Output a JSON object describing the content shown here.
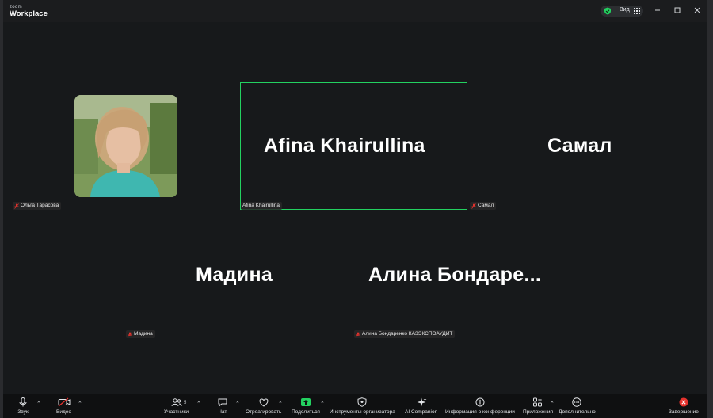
{
  "app": {
    "logo_small": "zoom",
    "logo_name": "Workplace",
    "view_label": "Вид"
  },
  "participants": [
    {
      "id": "olga",
      "display_name": "Ольга Тарасова",
      "tag": "Ольга Тарасова",
      "video": true
    },
    {
      "id": "afina",
      "display_name": "Afina Khairullina",
      "tag": "Afina Khairullina",
      "active_speaker": true
    },
    {
      "id": "samal",
      "display_name": "Самал",
      "tag": "Самал"
    },
    {
      "id": "madina",
      "display_name": "Мадина",
      "tag": "Мадина"
    },
    {
      "id": "alina",
      "display_name": "Алина  Бондаре...",
      "tag": "Алина Бондаренко КАЗЭКСПОАУДИТ"
    }
  ],
  "toolbar": {
    "audio": "Звук",
    "video": "Видео",
    "participants": "Участники",
    "participants_count": "5",
    "chat": "Чат",
    "react": "Отреагировать",
    "share": "Поделиться",
    "host_tools": "Инструменты организатора",
    "ai": "AI Companion",
    "info": "Информация о конференции",
    "apps": "Приложения",
    "more": "Дополнительно",
    "end": "Завершение"
  },
  "colors": {
    "accent_green": "#23d160",
    "share_green": "#23d160",
    "end_red": "#e5322d",
    "muted_red": "#e5322d"
  }
}
